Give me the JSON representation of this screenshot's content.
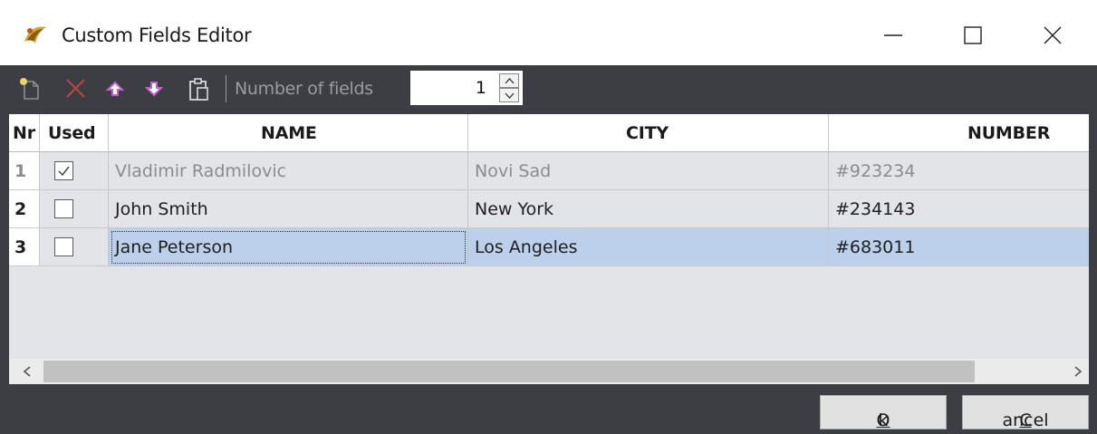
{
  "window": {
    "title": "Custom Fields Editor"
  },
  "toolbar": {
    "number_of_fields_label": "Number of fields",
    "number_of_fields_value": "1",
    "icons": [
      "new-field-icon",
      "delete-icon",
      "move-up-icon",
      "move-down-icon",
      "paste-icon"
    ]
  },
  "grid": {
    "columns": [
      "Nr",
      "Used",
      "NAME",
      "CITY",
      "NUMBER"
    ],
    "rows": [
      {
        "nr": "1",
        "used": true,
        "name": "Vladimir Radmilovic",
        "city": "Novi Sad",
        "number": "#923234",
        "state": "disabled"
      },
      {
        "nr": "2",
        "used": false,
        "name": "John Smith",
        "city": "New York",
        "number": "#234143",
        "state": "normal"
      },
      {
        "nr": "3",
        "used": false,
        "name": "Jane Peterson",
        "city": "Los Angeles",
        "number": "#683011",
        "state": "selected"
      }
    ]
  },
  "footer": {
    "ok_accel": "O",
    "ok_rest": "k",
    "cancel_accel": "C",
    "cancel_rest": "ancel"
  },
  "colors": {
    "chrome": "#3c3e43",
    "grid_bg": "#e3e4e8",
    "selection": "#bcd0ec",
    "delete_icon": "#c0392b",
    "arrow_icons": "#c060d0"
  }
}
